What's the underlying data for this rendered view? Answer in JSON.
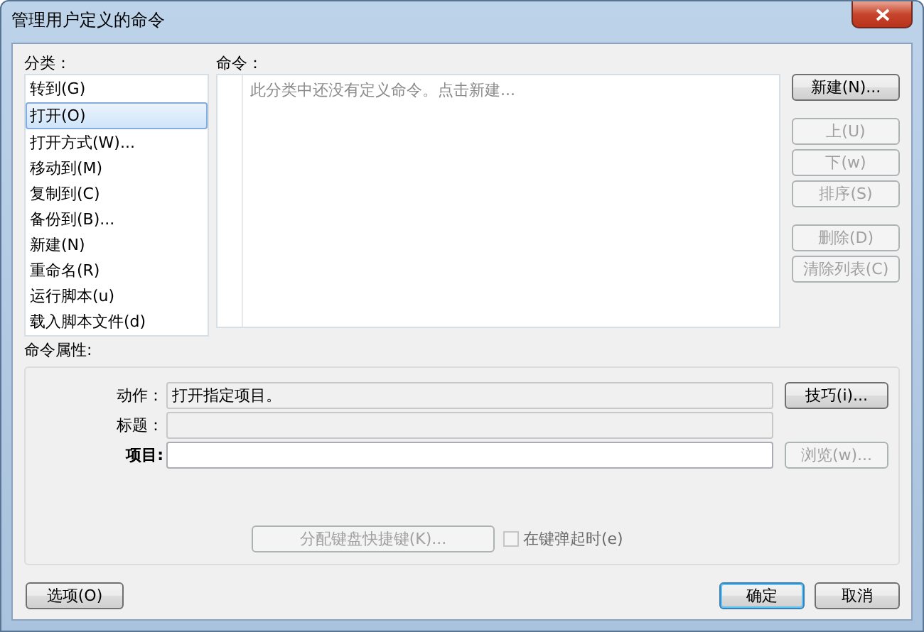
{
  "window": {
    "title": "管理用户定义的命令"
  },
  "categories": {
    "label": "分类：",
    "items": [
      {
        "label": "转到(G)",
        "selected": false
      },
      {
        "label": "打开(O)",
        "selected": true
      },
      {
        "label": "打开方式(W)...",
        "selected": false
      },
      {
        "label": "移动到(M)",
        "selected": false
      },
      {
        "label": "复制到(C)",
        "selected": false
      },
      {
        "label": "备份到(B)...",
        "selected": false
      },
      {
        "label": "新建(N)",
        "selected": false
      },
      {
        "label": "重命名(R)",
        "selected": false
      },
      {
        "label": "运行脚本(u)",
        "selected": false
      },
      {
        "label": "载入脚本文件(d)",
        "selected": false
      }
    ]
  },
  "commands": {
    "label": "命令：",
    "empty_text": "此分类中还没有定义命令。点击新建..."
  },
  "button_groups": [
    [
      {
        "label": "新建(N)...",
        "disabled": false
      }
    ],
    [
      {
        "label": "上(U)",
        "disabled": true
      },
      {
        "label": "下(w)",
        "disabled": true
      },
      {
        "label": "排序(S)",
        "disabled": true
      }
    ],
    [
      {
        "label": "删除(D)",
        "disabled": true
      },
      {
        "label": "清除列表(C)",
        "disabled": true
      }
    ]
  ],
  "properties": {
    "label": "命令属性:",
    "action": {
      "label": "动作：",
      "value": "打开指定项目。",
      "disabled": true
    },
    "title": {
      "label": "标题：",
      "disabled": true
    },
    "item": {
      "label": "项目:",
      "disabled": false
    },
    "tips_button": {
      "label": "技巧(i)...",
      "disabled": false
    },
    "browse_button": {
      "label": "浏览(w)...",
      "disabled": true
    },
    "shortcut_button": {
      "label": "分配键盘快捷键(K)...",
      "disabled": true
    },
    "on_key_up": {
      "label": "在键弹起时(e)",
      "checked": false,
      "disabled": true
    }
  },
  "footer": {
    "options_button": {
      "label": "选项(O)",
      "disabled": false
    },
    "ok_button": {
      "label": "确定",
      "disabled": false
    },
    "cancel_button": {
      "label": "取消",
      "disabled": false
    }
  }
}
